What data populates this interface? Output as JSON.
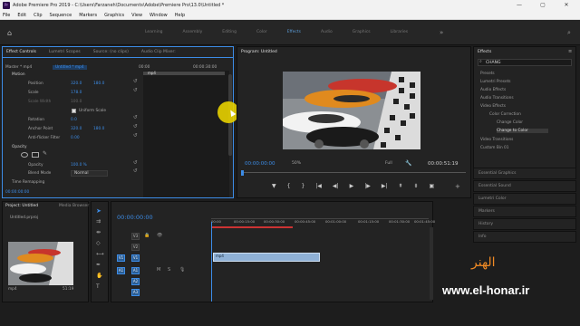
{
  "window": {
    "title": "Adobe Premiere Pro 2019 - C:\\Users\\Farzaneh\\Documents\\Adobe\\Premiere Pro\\13.0\\Untitled *",
    "app_icon": "Pr",
    "minimize": "—",
    "maximize": "▢",
    "close": "✕"
  },
  "menu": [
    "File",
    "Edit",
    "Clip",
    "Sequence",
    "Markers",
    "Graphics",
    "View",
    "Window",
    "Help"
  ],
  "workspaces": [
    "Learning",
    "Assembly",
    "Editing",
    "Color",
    "Effects",
    "Audio",
    "Graphics",
    "Libraries"
  ],
  "active_workspace": "Effects",
  "effect_controls": {
    "tabs": [
      "Effect Controls",
      "Lumetri Scopes",
      "Source: (no clips)",
      "Audio Clip Mixer:"
    ],
    "master": "Master * mp4",
    "clip": "Untitled * mp4",
    "timecode_start": "00:00",
    "timecode_end": "00:00:30:00",
    "clip_label": "mp4",
    "motion": "Motion",
    "position": "Position",
    "position_x": "320.0",
    "position_y": "180.0",
    "scale": "Scale",
    "scale_val": "178.0",
    "scale_width": "Scale Width",
    "scale_width_val": "100.0",
    "uniform_scale": "Uniform Scale",
    "rotation": "Rotation",
    "rotation_val": "0.0",
    "anchor": "Anchor Point",
    "anchor_x": "320.0",
    "anchor_y": "180.0",
    "anti_flicker": "Anti-flicker Filter",
    "anti_flicker_val": "0.00",
    "opacity_section": "Opacity",
    "opacity": "Opacity",
    "opacity_val": "100.0 %",
    "blend_mode": "Blend Mode",
    "blend_val": "Normal",
    "time_remapping": "Time Remapping",
    "bottom_time": "00:00:00:00"
  },
  "program": {
    "title": "Program: Untitled",
    "timecode": "00:00:00:00",
    "zoom": "50%",
    "quality": "Full",
    "duration": "00:00:51:19"
  },
  "project": {
    "tabs": [
      "Project: Untitled",
      "Media Browser"
    ],
    "file": "Untitled.prproj",
    "thumb_label": "mp4",
    "thumb_duration": "51:19"
  },
  "timeline": {
    "timecode": "00:00:00:00",
    "ruler": [
      "00:00",
      "00:00:15:00",
      "00:00:30:00",
      "00:00:45:00",
      "00:01:00:00",
      "00:01:15:00",
      "00:01:30:00",
      "00:01:45:00"
    ],
    "video_tracks": [
      "V3",
      "V2",
      "V1"
    ],
    "audio_tracks": [
      "A1",
      "A2",
      "A3"
    ],
    "clip_label": "mp4",
    "src_v": "V1",
    "src_a": "A1"
  },
  "effects": {
    "title": "Effects",
    "search": "CHANG",
    "items": [
      "Presets",
      "Lumetri Presets",
      "Audio Effects",
      "Audio Transitions",
      "Video Effects",
      "Color Correction",
      "Change Color",
      "Change to Color",
      "Video Transitions",
      "Custom Bin 01"
    ]
  },
  "right_panels": [
    "Essential Graphics",
    "Essential Sound",
    "Lumetri Color",
    "Markers",
    "History",
    "Info"
  ],
  "watermark": {
    "domain": "www.el-honar.ir",
    "logo_text": "الهنر"
  },
  "colors": {
    "accent": "#3c8ce7",
    "playhead": "#3c8ce7",
    "clip": "#8fb1d6",
    "cursor_highlight": "#e8d100"
  }
}
